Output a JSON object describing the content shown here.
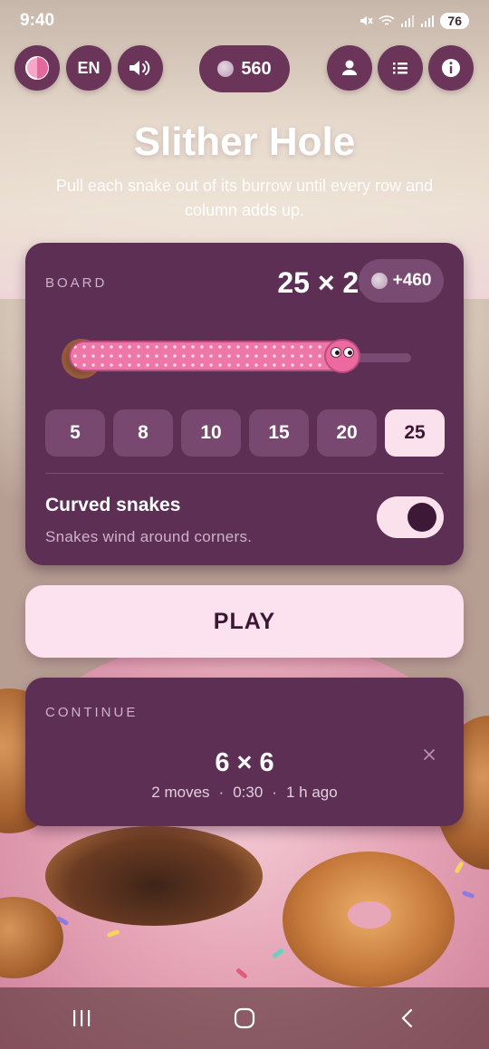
{
  "status_bar": {
    "time": "9:40",
    "battery": "76"
  },
  "top_bar": {
    "language": "EN",
    "coins": "560"
  },
  "header": {
    "title": "Slither Hole",
    "subtitle": "Pull each snake out of its burrow until every row and column adds up."
  },
  "board": {
    "label": "BOARD",
    "selected_size": "25 × 25",
    "bonus": "+460",
    "size_options": [
      "5",
      "8",
      "10",
      "15",
      "20",
      "25"
    ],
    "selected_index": 5,
    "option_title": "Curved snakes",
    "option_description": "Snakes wind around corners.",
    "curved_enabled": true
  },
  "play_label": "PLAY",
  "continue": {
    "label": "CONTINUE",
    "size": "6 × 6",
    "moves": "2 moves",
    "time": "0:30",
    "ago": "1 h ago",
    "separator": "·"
  },
  "icons": {
    "theme": "theme-toggle-icon",
    "sound": "speaker-icon",
    "coin": "coin-icon",
    "profile": "person-icon",
    "list": "list-icon",
    "info": "info-icon",
    "close": "close-icon"
  },
  "colors": {
    "card": "#5d2f55",
    "chip": "#784871",
    "chip_active": "#fbe1ec",
    "play_button": "#fce2ee",
    "accent_dark": "#3c1733"
  }
}
